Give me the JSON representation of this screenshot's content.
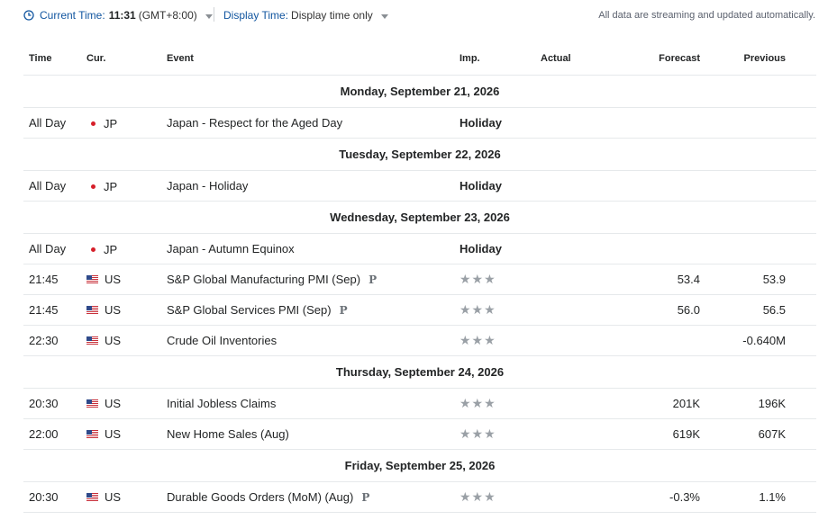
{
  "topbar": {
    "current_time_label": "Current Time:",
    "current_time_value": "11:31",
    "current_time_tz": "(GMT+8:00)",
    "display_time_label": "Display Time:",
    "display_time_value": "Display time only",
    "streaming_note": "All data are streaming and updated automatically."
  },
  "columns": {
    "time": "Time",
    "cur": "Cur.",
    "event": "Event",
    "imp": "Imp.",
    "actual": "Actual",
    "forecast": "Forecast",
    "previous": "Previous"
  },
  "days": [
    {
      "label": "Monday, September 21, 2026",
      "events": [
        {
          "time": "All Day",
          "currency": "JP",
          "flag": "jp-dot",
          "event": "Japan - Respect for the Aged Day",
          "preliminary": "",
          "importance": "Holiday",
          "actual": "",
          "forecast": "",
          "previous": ""
        }
      ]
    },
    {
      "label": "Tuesday, September 22, 2026",
      "events": [
        {
          "time": "All Day",
          "currency": "JP",
          "flag": "jp-dot",
          "event": "Japan - Holiday",
          "preliminary": "",
          "importance": "Holiday",
          "actual": "",
          "forecast": "",
          "previous": ""
        }
      ]
    },
    {
      "label": "Wednesday, September 23, 2026",
      "events": [
        {
          "time": "All Day",
          "currency": "JP",
          "flag": "jp-dot",
          "event": "Japan - Autumn Equinox",
          "preliminary": "",
          "importance": "Holiday",
          "actual": "",
          "forecast": "",
          "previous": ""
        },
        {
          "time": "21:45",
          "currency": "US",
          "flag": "us-flag",
          "event": "S&P Global Manufacturing PMI  (Sep)",
          "preliminary": "P",
          "importance": "★★★",
          "actual": "",
          "forecast": "53.4",
          "previous": "53.9"
        },
        {
          "time": "21:45",
          "currency": "US",
          "flag": "us-flag",
          "event": "S&P Global Services PMI  (Sep)",
          "preliminary": "P",
          "importance": "★★★",
          "actual": "",
          "forecast": "56.0",
          "previous": "56.5"
        },
        {
          "time": "22:30",
          "currency": "US",
          "flag": "us-flag",
          "event": "Crude Oil Inventories",
          "preliminary": "",
          "importance": "★★★",
          "actual": "",
          "forecast": "",
          "previous": "-0.640M"
        }
      ]
    },
    {
      "label": "Thursday, September 24, 2026",
      "events": [
        {
          "time": "20:30",
          "currency": "US",
          "flag": "us-flag",
          "event": "Initial Jobless Claims",
          "preliminary": "",
          "importance": "★★★",
          "actual": "",
          "forecast": "201K",
          "previous": "196K"
        },
        {
          "time": "22:00",
          "currency": "US",
          "flag": "us-flag",
          "event": "New Home Sales  (Aug)",
          "preliminary": "",
          "importance": "★★★",
          "actual": "",
          "forecast": "619K",
          "previous": "607K"
        }
      ]
    },
    {
      "label": "Friday, September 25, 2026",
      "events": [
        {
          "time": "20:30",
          "currency": "US",
          "flag": "us-flag",
          "event": "Durable Goods Orders (MoM) (Aug)",
          "preliminary": "P",
          "importance": "★★★",
          "actual": "",
          "forecast": "-0.3%",
          "previous": "1.1%"
        }
      ]
    }
  ],
  "colors": {
    "link_blue": "#1256a0",
    "jp_red": "#d61f2a",
    "star_gray": "#9aa0a6",
    "divider": "#e6e9eb"
  }
}
